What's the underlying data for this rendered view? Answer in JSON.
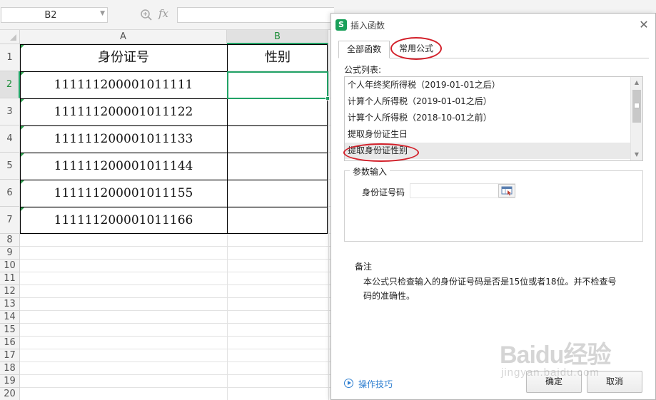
{
  "formula_bar": {
    "name_box": "B2",
    "fx_label": "fx"
  },
  "sheet": {
    "columns": [
      "A",
      "B"
    ],
    "rows": [
      "1",
      "2",
      "3",
      "4",
      "5",
      "6",
      "7",
      "8",
      "9",
      "10",
      "11",
      "12",
      "13",
      "14",
      "15",
      "16",
      "17",
      "18",
      "19",
      "20"
    ],
    "headers": [
      "身份证号",
      "性别"
    ],
    "ids": [
      "111111200001011111",
      "111111200001011122",
      "111111200001011133",
      "111111200001011144",
      "111111200001011155",
      "111111200001011166"
    ],
    "selected_cell": "B2",
    "accent_color": "#21a366"
  },
  "dialog": {
    "title": "插入函数",
    "app_icon": "S",
    "tabs": [
      "全部函数",
      "常用公式"
    ],
    "active_tab": "常用公式",
    "list_label": "公式列表:",
    "formulas": [
      "个人年终奖所得税（2019-01-01之后）",
      "计算个人所得税（2019-01-01之后）",
      "计算个人所得税（2018-10-01之前）",
      "提取身份证生日",
      "提取身份证性别"
    ],
    "selected_formula": "提取身份证性别",
    "param_group_label": "参数输入",
    "param_label": "身份证号码",
    "param_value": "",
    "notes_title": "备注",
    "notes_text": "本公式只检查输入的身份证号码是否是15位或者18位。并不检查号码的准确性。",
    "tips_link": "操作技巧",
    "ok_label": "确定",
    "cancel_label": "取消",
    "highlight_color": "#d3202a"
  },
  "watermark": {
    "logo": "Baidu经验",
    "sub": "jingyan.baidu.com"
  }
}
